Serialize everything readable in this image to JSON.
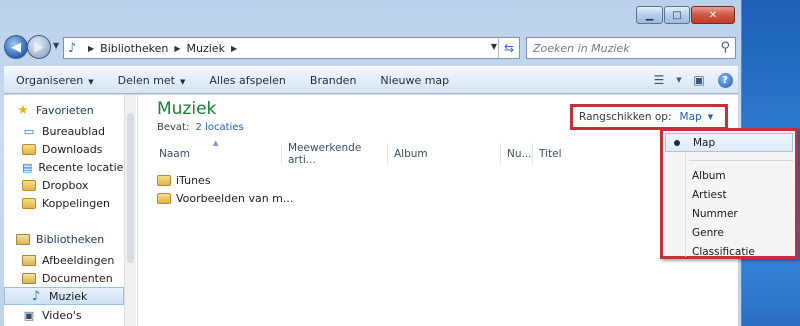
{
  "window": {
    "minimize_label": "▁",
    "maximize_label": "□",
    "close_label": "✕"
  },
  "address": {
    "crumbs": [
      "Bibliotheken",
      "Muziek"
    ],
    "search_placeholder": "Zoeken in Muziek"
  },
  "toolbar": {
    "organize": "Organiseren",
    "share": "Delen met",
    "play_all": "Alles afspelen",
    "burn": "Branden",
    "new_folder": "Nieuwe map"
  },
  "nav": {
    "favorites_label": "Favorieten",
    "favorites": [
      "Bureaublad",
      "Downloads",
      "Recente locaties",
      "Dropbox",
      "Koppelingen"
    ],
    "libraries_label": "Bibliotheken",
    "libraries": [
      "Afbeeldingen",
      "Documenten",
      "Muziek",
      "Video's"
    ],
    "selected": "Muziek"
  },
  "main": {
    "title": "Muziek",
    "contains_label": "Bevat:",
    "locations_link": "2 locaties",
    "arrange_label": "Rangschikken op:",
    "arrange_value": "Map",
    "columns": [
      "Naam",
      "Meewerkende arti...",
      "Album",
      "Nu...",
      "Titel"
    ],
    "rows": [
      "iTunes",
      "Voorbeelden van m..."
    ]
  },
  "menu": {
    "checked_item": "Map",
    "items": [
      "Album",
      "Artiest",
      "Nummer",
      "Genre",
      "Classificatie"
    ]
  },
  "colors": {
    "highlight_red": "#c83038",
    "title_green": "#1b7f2d",
    "link_blue": "#1e5ebd"
  }
}
